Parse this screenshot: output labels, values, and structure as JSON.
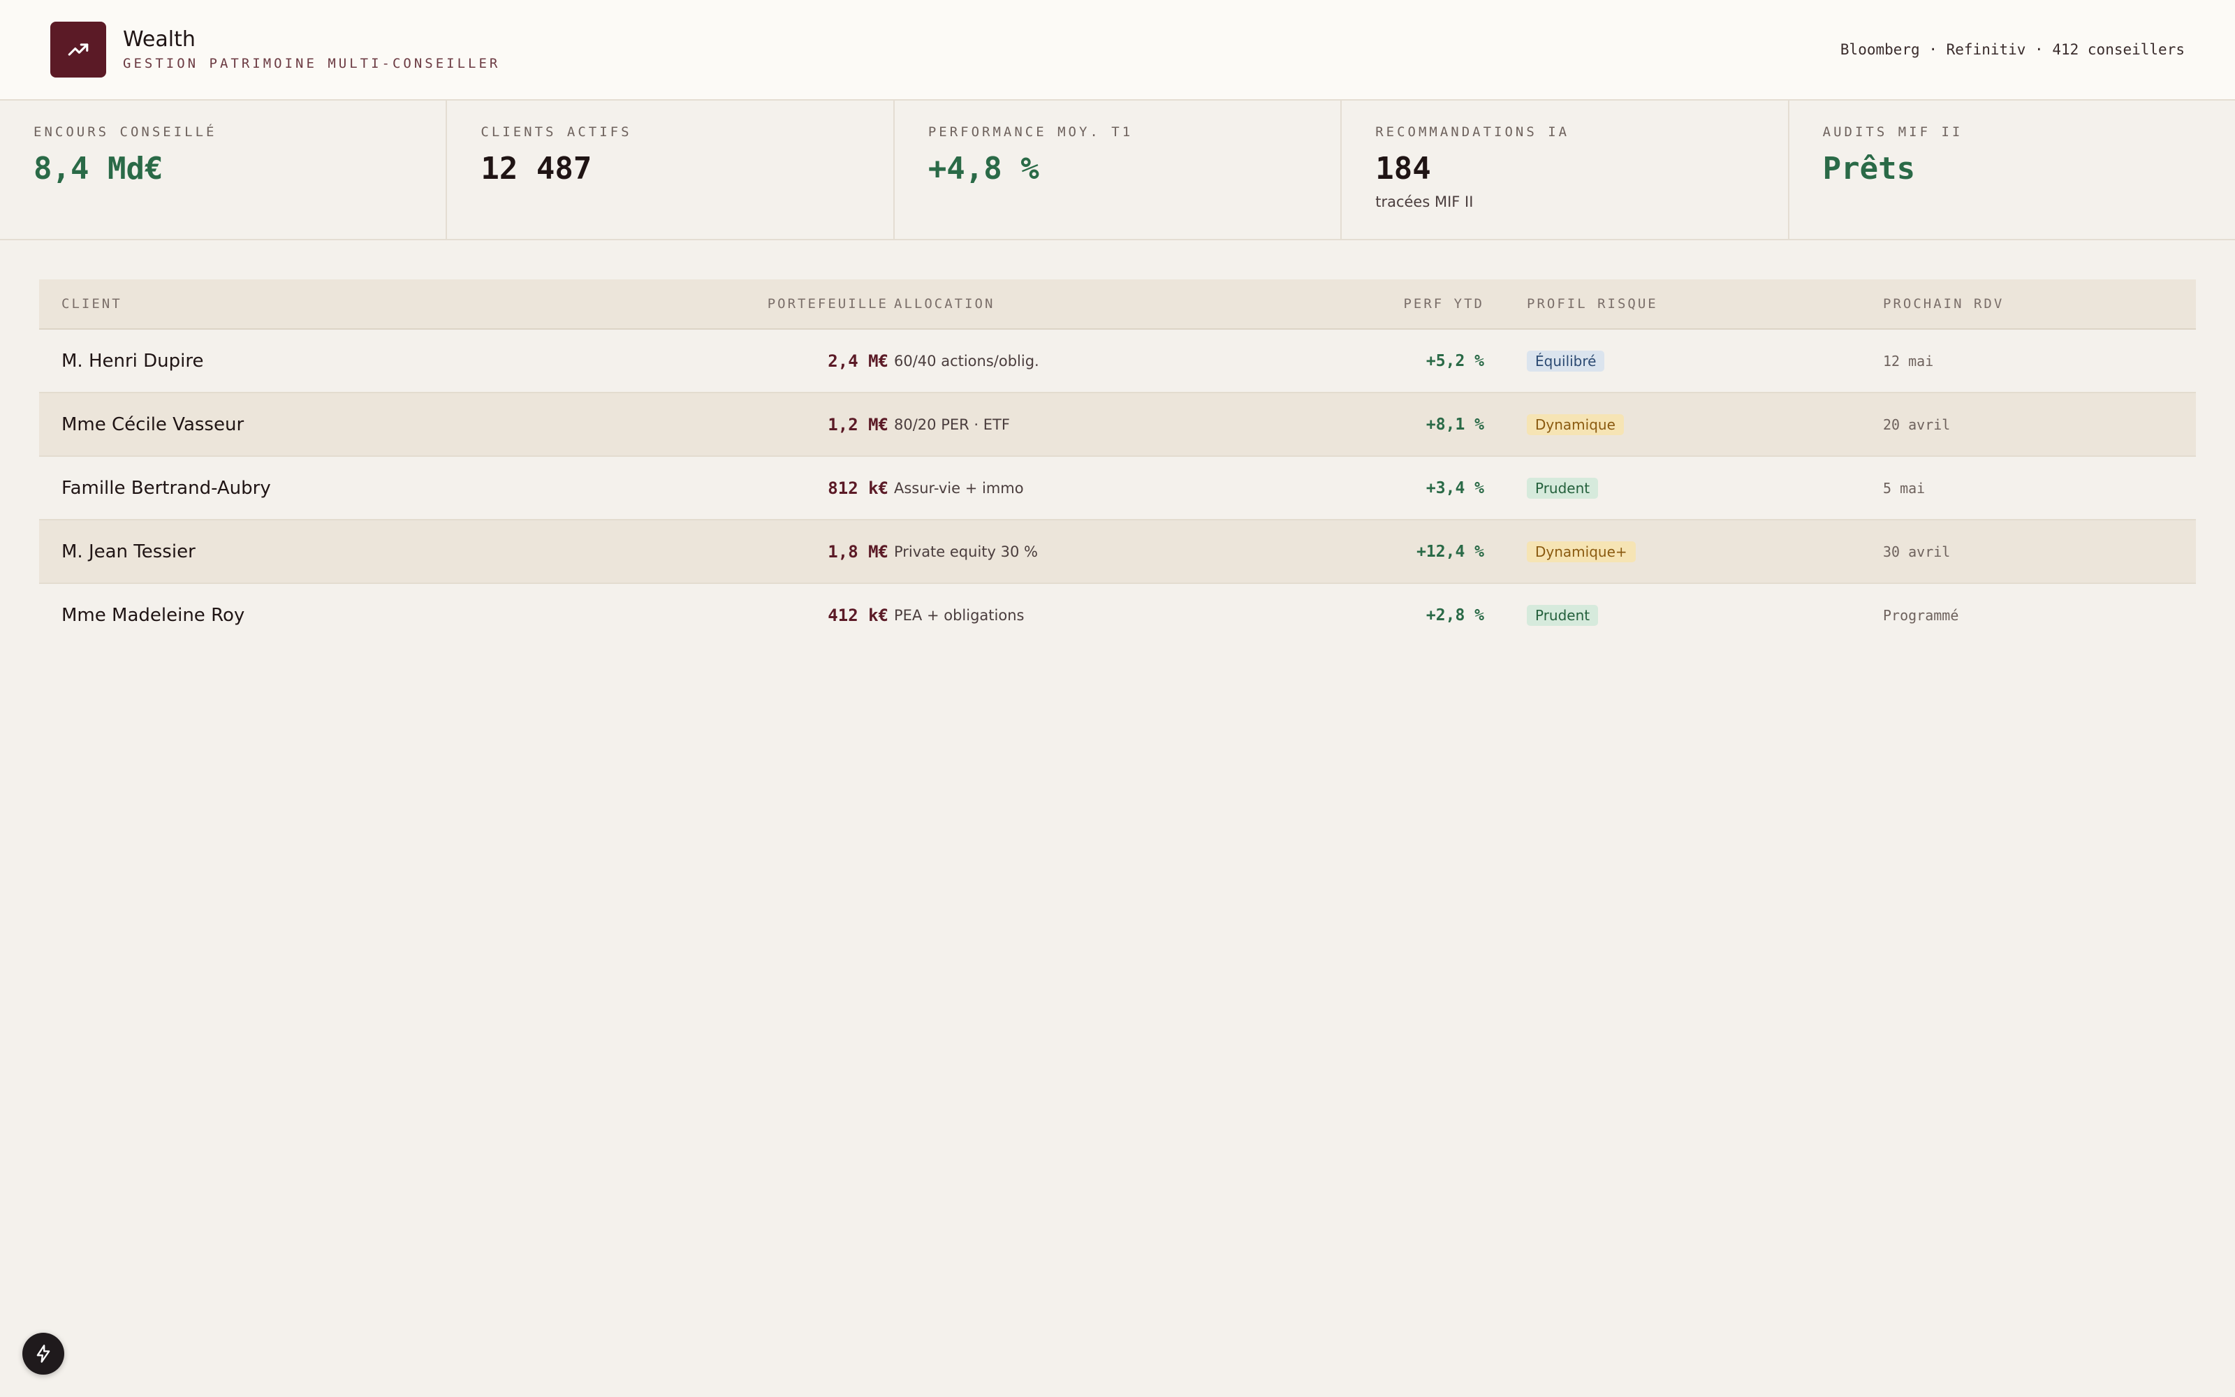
{
  "app": {
    "title": "Wealth",
    "subtitle": "GESTION PATRIMOINE MULTI-CONSEILLER",
    "meta": "Bloomberg · Refinitiv · 412 conseillers",
    "logo_icon": "trending-up-icon"
  },
  "kpis": [
    {
      "label": "ENCOURS CONSEILLÉ",
      "value": "8,4 Md€",
      "sub": "",
      "color": "#2a6a47"
    },
    {
      "label": "CLIENTS ACTIFS",
      "value": "12 487",
      "sub": "",
      "color": "#1f1414"
    },
    {
      "label": "PERFORMANCE MOY. T1",
      "value": "+4,8 %",
      "sub": "",
      "color": "#2a6a47"
    },
    {
      "label": "RECOMMANDATIONS IA",
      "value": "184",
      "sub": "tracées MIF II",
      "color": "#1f1414"
    },
    {
      "label": "AUDITS MIF II",
      "value": "Prêts",
      "sub": "",
      "color": "#2a6a47"
    }
  ],
  "table": {
    "headers": {
      "client": "CLIENT",
      "portfolio": "PORTEFEUILLE",
      "allocation": "ALLOCATION",
      "perf": "PERF YTD",
      "risk": "PROFIL RISQUE",
      "rdv": "PROCHAIN RDV"
    },
    "rows": [
      {
        "client": "M. Henri Dupire",
        "portfolio": "2,4 M€",
        "allocation": "60/40 actions/oblig.",
        "perf": "+5,2 %",
        "risk": "Équilibré",
        "risk_color": "blue",
        "rdv": "12 mai"
      },
      {
        "client": "Mme Cécile Vasseur",
        "portfolio": "1,2 M€",
        "allocation": "80/20 PER · ETF",
        "perf": "+8,1 %",
        "risk": "Dynamique",
        "risk_color": "yellow",
        "rdv": "20 avril"
      },
      {
        "client": "Famille Bertrand-Aubry",
        "portfolio": "812 k€",
        "allocation": "Assur-vie + immo",
        "perf": "+3,4 %",
        "risk": "Prudent",
        "risk_color": "green",
        "rdv": "5 mai"
      },
      {
        "client": "M. Jean Tessier",
        "portfolio": "1,8 M€",
        "allocation": "Private equity 30 %",
        "perf": "+12,4 %",
        "risk": "Dynamique+",
        "risk_color": "yellow",
        "rdv": "30 avril"
      },
      {
        "client": "Mme Madeleine Roy",
        "portfolio": "412 k€",
        "allocation": "PEA + obligations",
        "perf": "+2,8 %",
        "risk": "Prudent",
        "risk_color": "green",
        "rdv": "Programmé"
      }
    ]
  },
  "fab": {
    "icon": "bolt-icon"
  }
}
